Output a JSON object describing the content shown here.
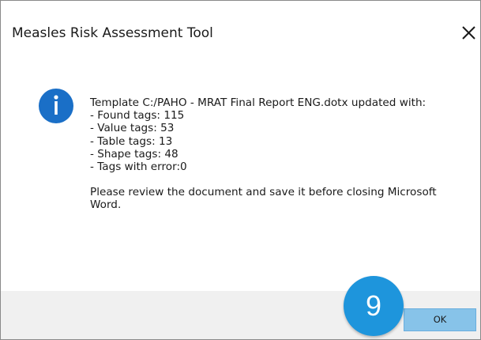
{
  "window": {
    "title": "Measles Risk Assessment Tool",
    "close_icon": "close-icon"
  },
  "message": {
    "icon": "info-icon",
    "icon_color": "#1a6fc7",
    "lines": [
      "Template C:/PAHO - MRAT Final Report ENG.dotx updated with:",
      "- Found tags: 115",
      "- Value tags: 53",
      "- Table tags: 13",
      "- Shape tags: 48",
      "- Tags with error:0"
    ],
    "note": "Please review the document and save it before closing Microsoft Word."
  },
  "footer": {
    "ok_label": "OK"
  },
  "overlay": {
    "step_number": "9",
    "step_color": "#1e95dc"
  }
}
